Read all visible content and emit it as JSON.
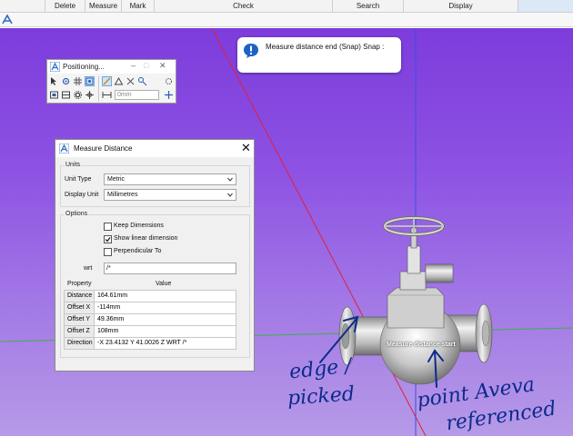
{
  "ribbon": {
    "groups": [
      "Delete",
      "Measure",
      "Mark",
      "Check",
      "Search",
      "Display"
    ]
  },
  "prompt": {
    "icon": "info-icon",
    "text": "Measure distance end (Snap) Snap :"
  },
  "positioning": {
    "title": "Positioning...",
    "offset_value": "0mm"
  },
  "measure_dialog": {
    "title": "Measure Distance",
    "units_group": "Units",
    "unit_type_label": "Unit Type",
    "unit_type_value": "Metric",
    "display_unit_label": "Display Unit",
    "display_unit_value": "Millimetres",
    "options_group": "Options",
    "keep_dimensions": {
      "label": "Keep Dimensions",
      "checked": false
    },
    "show_linear": {
      "label": "Show linear dimension",
      "checked": true
    },
    "perpendicular": {
      "label": "Perpendicular To",
      "checked": false
    },
    "wrt_label": "wrt",
    "wrt_value": "/*",
    "table": {
      "headers": [
        "Property",
        "Value"
      ],
      "rows": [
        {
          "property": "Distance",
          "value": "164.61mm"
        },
        {
          "property": "Offset X",
          "value": "-114mm"
        },
        {
          "property": "Offset Y",
          "value": "49.36mm"
        },
        {
          "property": "Offset Z",
          "value": "108mm"
        },
        {
          "property": "Direction",
          "value": "-X 23.4132 Y 41.0026 Z WRT /*"
        }
      ]
    }
  },
  "viewport": {
    "start_label": "Measure distance start",
    "handwritten": {
      "edge_line1": "edge /",
      "edge_line2": "picked",
      "point_line1": "point Aveva",
      "point_line2": "referenced"
    }
  },
  "colors": {
    "viewport_top": "#7d3cdc",
    "viewport_bottom": "#b69ae7",
    "handwriting": "#0c2a8c",
    "axis_red": "#e0203c",
    "axis_blue": "#3b4fe0",
    "axis_green": "#3fae4b"
  }
}
